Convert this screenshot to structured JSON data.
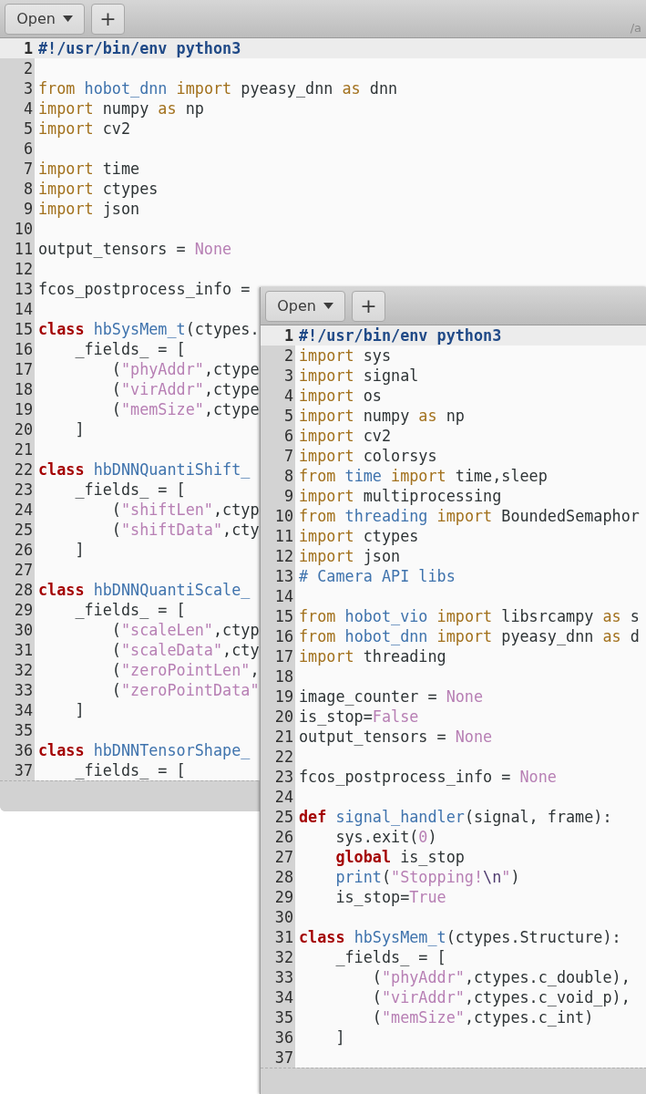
{
  "windows": [
    {
      "header": {
        "open_button": "Open",
        "new_tab_button": "+",
        "subtitle": "/a"
      },
      "lines": [
        {
          "number": "1",
          "current": true,
          "tokens": [
            {
              "kind": "shebang",
              "text": "#!/usr/bin/env python3"
            }
          ]
        },
        {
          "number": "2",
          "current": false
        },
        {
          "number": "3",
          "current": false,
          "tokens": [
            {
              "kind": "kw",
              "text": "from"
            },
            {
              "kind": "mod",
              "text": " hobot_dnn"
            },
            {
              "kind": "kw",
              "text": " import"
            },
            {
              "kind": "plain",
              "text": " pyeasy_dnn "
            },
            {
              "kind": "kw",
              "text": "as"
            },
            {
              "kind": "plain",
              "text": " dnn"
            }
          ]
        },
        {
          "number": "4",
          "current": false,
          "tokens": [
            {
              "kind": "kw",
              "text": "import"
            },
            {
              "kind": "plain",
              "text": " numpy "
            },
            {
              "kind": "kw",
              "text": "as"
            },
            {
              "kind": "plain",
              "text": " np"
            }
          ]
        },
        {
          "number": "5",
          "current": false,
          "tokens": [
            {
              "kind": "kw",
              "text": "import"
            },
            {
              "kind": "plain",
              "text": " cv2"
            }
          ]
        },
        {
          "number": "6",
          "current": false
        },
        {
          "number": "7",
          "current": false,
          "tokens": [
            {
              "kind": "kw",
              "text": "import"
            },
            {
              "kind": "plain",
              "text": " time"
            }
          ]
        },
        {
          "number": "8",
          "current": false,
          "tokens": [
            {
              "kind": "kw",
              "text": "import"
            },
            {
              "kind": "plain",
              "text": " ctypes"
            }
          ]
        },
        {
          "number": "9",
          "current": false,
          "tokens": [
            {
              "kind": "kw",
              "text": "import"
            },
            {
              "kind": "plain",
              "text": " json"
            }
          ]
        },
        {
          "number": "10",
          "current": false
        },
        {
          "number": "11",
          "current": false,
          "tokens": [
            {
              "kind": "plain",
              "text": "output_tensors = "
            },
            {
              "kind": "str",
              "text": "None"
            }
          ]
        },
        {
          "number": "12",
          "current": false
        },
        {
          "number": "13",
          "current": false,
          "tokens": [
            {
              "kind": "plain",
              "text": "fcos_postprocess_info ="
            }
          ]
        },
        {
          "number": "14",
          "current": false
        },
        {
          "number": "15",
          "current": false,
          "tokens": [
            {
              "kind": "decl",
              "text": "class"
            },
            {
              "kind": "func",
              "text": " hbSysMem_t"
            },
            {
              "kind": "plain",
              "text": "(ctypes."
            }
          ]
        },
        {
          "number": "16",
          "current": false,
          "tokens": [
            {
              "kind": "plain",
              "text": "    _fields_ = ["
            }
          ]
        },
        {
          "number": "17",
          "current": false,
          "tokens": [
            {
              "kind": "plain",
              "text": "        ("
            },
            {
              "kind": "str",
              "text": "\"phyAddr\""
            },
            {
              "kind": "plain",
              "text": ",ctype"
            }
          ]
        },
        {
          "number": "18",
          "current": false,
          "tokens": [
            {
              "kind": "plain",
              "text": "        ("
            },
            {
              "kind": "str",
              "text": "\"virAddr\""
            },
            {
              "kind": "plain",
              "text": ",ctype"
            }
          ]
        },
        {
          "number": "19",
          "current": false,
          "tokens": [
            {
              "kind": "plain",
              "text": "        ("
            },
            {
              "kind": "str",
              "text": "\"memSize\""
            },
            {
              "kind": "plain",
              "text": ",ctype"
            }
          ]
        },
        {
          "number": "20",
          "current": false,
          "tokens": [
            {
              "kind": "plain",
              "text": "    ]"
            }
          ]
        },
        {
          "number": "21",
          "current": false
        },
        {
          "number": "22",
          "current": false,
          "tokens": [
            {
              "kind": "decl",
              "text": "class"
            },
            {
              "kind": "func",
              "text": " hbDNNQuantiShift_"
            }
          ]
        },
        {
          "number": "23",
          "current": false,
          "tokens": [
            {
              "kind": "plain",
              "text": "    _fields_ = ["
            }
          ]
        },
        {
          "number": "24",
          "current": false,
          "tokens": [
            {
              "kind": "plain",
              "text": "        ("
            },
            {
              "kind": "str",
              "text": "\"shiftLen\""
            },
            {
              "kind": "plain",
              "text": ",ctyp"
            }
          ]
        },
        {
          "number": "25",
          "current": false,
          "tokens": [
            {
              "kind": "plain",
              "text": "        ("
            },
            {
              "kind": "str",
              "text": "\"shiftData\""
            },
            {
              "kind": "plain",
              "text": ",cty"
            }
          ]
        },
        {
          "number": "26",
          "current": false,
          "tokens": [
            {
              "kind": "plain",
              "text": "    ]"
            }
          ]
        },
        {
          "number": "27",
          "current": false
        },
        {
          "number": "28",
          "current": false,
          "tokens": [
            {
              "kind": "decl",
              "text": "class"
            },
            {
              "kind": "func",
              "text": " hbDNNQuantiScale_"
            }
          ]
        },
        {
          "number": "29",
          "current": false,
          "tokens": [
            {
              "kind": "plain",
              "text": "    _fields_ = ["
            }
          ]
        },
        {
          "number": "30",
          "current": false,
          "tokens": [
            {
              "kind": "plain",
              "text": "        ("
            },
            {
              "kind": "str",
              "text": "\"scaleLen\""
            },
            {
              "kind": "plain",
              "text": ",ctyp"
            }
          ]
        },
        {
          "number": "31",
          "current": false,
          "tokens": [
            {
              "kind": "plain",
              "text": "        ("
            },
            {
              "kind": "str",
              "text": "\"scaleData\""
            },
            {
              "kind": "plain",
              "text": ",cty"
            }
          ]
        },
        {
          "number": "32",
          "current": false,
          "tokens": [
            {
              "kind": "plain",
              "text": "        ("
            },
            {
              "kind": "str",
              "text": "\"zeroPointLen\""
            },
            {
              "kind": "plain",
              "text": ","
            }
          ]
        },
        {
          "number": "33",
          "current": false,
          "tokens": [
            {
              "kind": "plain",
              "text": "        ("
            },
            {
              "kind": "str",
              "text": "\"zeroPointData\""
            }
          ]
        },
        {
          "number": "34",
          "current": false,
          "tokens": [
            {
              "kind": "plain",
              "text": "    ]"
            }
          ]
        },
        {
          "number": "35",
          "current": false
        },
        {
          "number": "36",
          "current": false,
          "tokens": [
            {
              "kind": "decl",
              "text": "class"
            },
            {
              "kind": "func",
              "text": " hbDNNTensorShape_"
            }
          ]
        },
        {
          "number": "37",
          "current": false,
          "tokens": [
            {
              "kind": "plain",
              "text": "    _fields_ = ["
            }
          ]
        }
      ]
    },
    {
      "header": {
        "open_button": "Open",
        "new_tab_button": "+"
      },
      "lines": [
        {
          "number": "1",
          "current": true,
          "tokens": [
            {
              "kind": "shebang",
              "text": "#!/usr/bin/env python3"
            }
          ]
        },
        {
          "number": "2",
          "current": false,
          "tokens": [
            {
              "kind": "kw",
              "text": "import"
            },
            {
              "kind": "plain",
              "text": " sys"
            }
          ]
        },
        {
          "number": "3",
          "current": false,
          "tokens": [
            {
              "kind": "kw",
              "text": "import"
            },
            {
              "kind": "plain",
              "text": " signal"
            }
          ]
        },
        {
          "number": "4",
          "current": false,
          "tokens": [
            {
              "kind": "kw",
              "text": "import"
            },
            {
              "kind": "plain",
              "text": " os"
            }
          ]
        },
        {
          "number": "5",
          "current": false,
          "tokens": [
            {
              "kind": "kw",
              "text": "import"
            },
            {
              "kind": "plain",
              "text": " numpy "
            },
            {
              "kind": "kw",
              "text": "as"
            },
            {
              "kind": "plain",
              "text": " np"
            }
          ]
        },
        {
          "number": "6",
          "current": false,
          "tokens": [
            {
              "kind": "kw",
              "text": "import"
            },
            {
              "kind": "plain",
              "text": " cv2"
            }
          ]
        },
        {
          "number": "7",
          "current": false,
          "tokens": [
            {
              "kind": "kw",
              "text": "import"
            },
            {
              "kind": "plain",
              "text": " colorsys"
            }
          ]
        },
        {
          "number": "8",
          "current": false,
          "tokens": [
            {
              "kind": "kw",
              "text": "from"
            },
            {
              "kind": "mod",
              "text": " time"
            },
            {
              "kind": "kw",
              "text": " import"
            },
            {
              "kind": "plain",
              "text": " time,sleep"
            }
          ]
        },
        {
          "number": "9",
          "current": false,
          "tokens": [
            {
              "kind": "kw",
              "text": "import"
            },
            {
              "kind": "plain",
              "text": " multiprocessing"
            }
          ]
        },
        {
          "number": "10",
          "current": false,
          "tokens": [
            {
              "kind": "kw",
              "text": "from"
            },
            {
              "kind": "mod",
              "text": " threading"
            },
            {
              "kind": "kw",
              "text": " import"
            },
            {
              "kind": "plain",
              "text": " BoundedSemaphor"
            }
          ]
        },
        {
          "number": "11",
          "current": false,
          "tokens": [
            {
              "kind": "kw",
              "text": "import"
            },
            {
              "kind": "plain",
              "text": " ctypes"
            }
          ]
        },
        {
          "number": "12",
          "current": false,
          "tokens": [
            {
              "kind": "kw",
              "text": "import"
            },
            {
              "kind": "plain",
              "text": " json"
            }
          ]
        },
        {
          "number": "13",
          "current": false,
          "tokens": [
            {
              "kind": "comment",
              "text": "# Camera API libs"
            }
          ]
        },
        {
          "number": "14",
          "current": false
        },
        {
          "number": "15",
          "current": false,
          "tokens": [
            {
              "kind": "kw",
              "text": "from"
            },
            {
              "kind": "mod",
              "text": " hobot_vio"
            },
            {
              "kind": "kw",
              "text": " import"
            },
            {
              "kind": "plain",
              "text": " libsrcampy "
            },
            {
              "kind": "kw",
              "text": "as"
            },
            {
              "kind": "plain",
              "text": " s"
            }
          ]
        },
        {
          "number": "16",
          "current": false,
          "tokens": [
            {
              "kind": "kw",
              "text": "from"
            },
            {
              "kind": "mod",
              "text": " hobot_dnn"
            },
            {
              "kind": "kw",
              "text": " import"
            },
            {
              "kind": "plain",
              "text": " pyeasy_dnn "
            },
            {
              "kind": "kw",
              "text": "as"
            },
            {
              "kind": "plain",
              "text": " d"
            }
          ]
        },
        {
          "number": "17",
          "current": false,
          "tokens": [
            {
              "kind": "kw",
              "text": "import"
            },
            {
              "kind": "plain",
              "text": " threading"
            }
          ]
        },
        {
          "number": "18",
          "current": false
        },
        {
          "number": "19",
          "current": false,
          "tokens": [
            {
              "kind": "plain",
              "text": "image_counter = "
            },
            {
              "kind": "str",
              "text": "None"
            }
          ]
        },
        {
          "number": "20",
          "current": false,
          "tokens": [
            {
              "kind": "plain",
              "text": "is_stop="
            },
            {
              "kind": "str",
              "text": "False"
            }
          ]
        },
        {
          "number": "21",
          "current": false,
          "tokens": [
            {
              "kind": "plain",
              "text": "output_tensors = "
            },
            {
              "kind": "str",
              "text": "None"
            }
          ]
        },
        {
          "number": "22",
          "current": false
        },
        {
          "number": "23",
          "current": false,
          "tokens": [
            {
              "kind": "plain",
              "text": "fcos_postprocess_info = "
            },
            {
              "kind": "str",
              "text": "None"
            }
          ]
        },
        {
          "number": "24",
          "current": false
        },
        {
          "number": "25",
          "current": false,
          "tokens": [
            {
              "kind": "decl",
              "text": "def"
            },
            {
              "kind": "func",
              "text": " signal_handler"
            },
            {
              "kind": "plain",
              "text": "(signal, frame):"
            }
          ]
        },
        {
          "number": "26",
          "current": false,
          "tokens": [
            {
              "kind": "plain",
              "text": "    sys.exit("
            },
            {
              "kind": "str",
              "text": "0"
            },
            {
              "kind": "plain",
              "text": ")"
            }
          ]
        },
        {
          "number": "27",
          "current": false,
          "tokens": [
            {
              "kind": "decl",
              "text": "    global"
            },
            {
              "kind": "plain",
              "text": " is_stop"
            }
          ]
        },
        {
          "number": "28",
          "current": false,
          "tokens": [
            {
              "kind": "func",
              "text": "    print"
            },
            {
              "kind": "plain",
              "text": "("
            },
            {
              "kind": "str",
              "text": "\"Stopping!"
            },
            {
              "kind": "esc",
              "text": "\\n"
            },
            {
              "kind": "str",
              "text": "\""
            },
            {
              "kind": "plain",
              "text": ")"
            }
          ]
        },
        {
          "number": "29",
          "current": false,
          "tokens": [
            {
              "kind": "plain",
              "text": "    is_stop="
            },
            {
              "kind": "str",
              "text": "True"
            }
          ]
        },
        {
          "number": "30",
          "current": false
        },
        {
          "number": "31",
          "current": false,
          "tokens": [
            {
              "kind": "decl",
              "text": "class"
            },
            {
              "kind": "func",
              "text": " hbSysMem_t"
            },
            {
              "kind": "plain",
              "text": "(ctypes.Structure):"
            }
          ]
        },
        {
          "number": "32",
          "current": false,
          "tokens": [
            {
              "kind": "plain",
              "text": "    _fields_ = ["
            }
          ]
        },
        {
          "number": "33",
          "current": false,
          "tokens": [
            {
              "kind": "plain",
              "text": "        ("
            },
            {
              "kind": "str",
              "text": "\"phyAddr\""
            },
            {
              "kind": "plain",
              "text": ",ctypes.c_double),"
            }
          ]
        },
        {
          "number": "34",
          "current": false,
          "tokens": [
            {
              "kind": "plain",
              "text": "        ("
            },
            {
              "kind": "str",
              "text": "\"virAddr\""
            },
            {
              "kind": "plain",
              "text": ",ctypes.c_void_p),"
            }
          ]
        },
        {
          "number": "35",
          "current": false,
          "tokens": [
            {
              "kind": "plain",
              "text": "        ("
            },
            {
              "kind": "str",
              "text": "\"memSize\""
            },
            {
              "kind": "plain",
              "text": ",ctypes.c_int)"
            }
          ]
        },
        {
          "number": "36",
          "current": false,
          "tokens": [
            {
              "kind": "plain",
              "text": "    ]"
            }
          ]
        },
        {
          "number": "37",
          "current": false
        }
      ]
    }
  ]
}
